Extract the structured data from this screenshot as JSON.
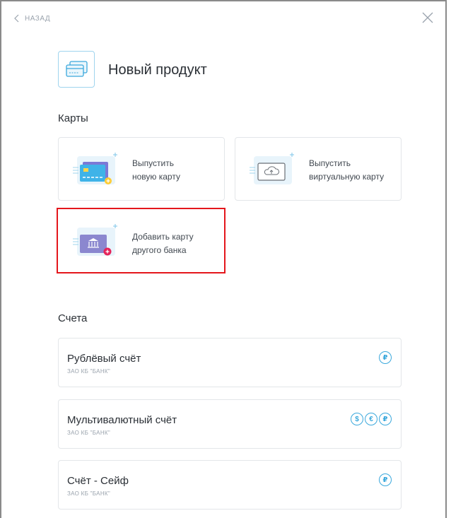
{
  "nav": {
    "back_label": "НАЗАД"
  },
  "header": {
    "title": "Новый продукт"
  },
  "cards_section": {
    "title": "Карты",
    "items": [
      {
        "line1": "Выпустить",
        "line2": "новую карту"
      },
      {
        "line1": "Выпустить",
        "line2": "виртуальную карту"
      },
      {
        "line1": "Добавить карту",
        "line2": "другого банка"
      }
    ]
  },
  "accounts_section": {
    "title": "Счета",
    "items": [
      {
        "name": "Рублёвый счёт",
        "bank": "ЗАО КБ \"БАНК\"",
        "currencies": [
          "₽"
        ]
      },
      {
        "name": "Мультивалютный счёт",
        "bank": "ЗАО КБ \"БАНК\"",
        "currencies": [
          "$",
          "€",
          "₽"
        ]
      },
      {
        "name": "Счёт - Сейф",
        "bank": "ЗАО КБ \"БАНК\"",
        "currencies": [
          "₽"
        ]
      }
    ]
  },
  "colors": {
    "accent": "#3aa8dc",
    "highlight": "#e4161c",
    "border": "#e3e6e9"
  }
}
